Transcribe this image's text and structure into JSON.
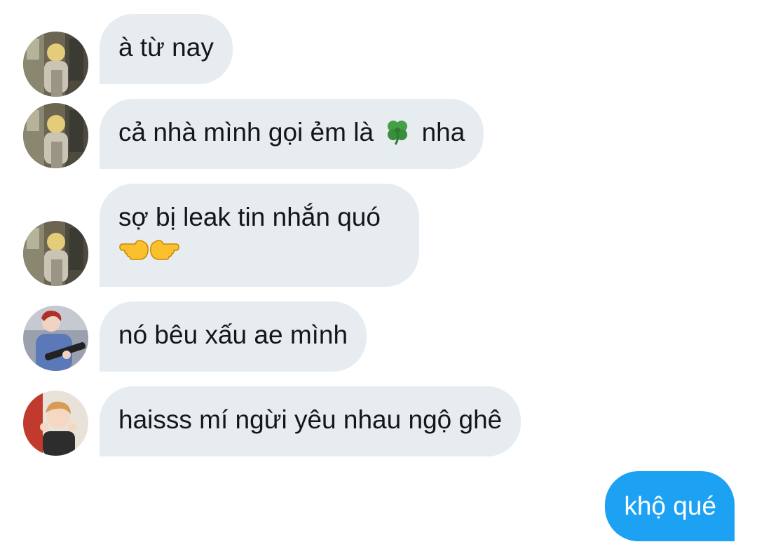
{
  "conversation": {
    "messages": [
      {
        "direction": "incoming",
        "sender_avatar": "avatar-blonde-street",
        "text": "à từ nay"
      },
      {
        "direction": "incoming",
        "sender_avatar": "avatar-blonde-street",
        "text_before_emoji": "cả nhà mình gọi ẻm là",
        "emoji": "four-leaf-clover",
        "text_after_emoji": "nha"
      },
      {
        "direction": "incoming",
        "sender_avatar": "avatar-blonde-street",
        "text": "sợ bị leak tin nhắn quó",
        "emojis": [
          "left-pointing-hand",
          "right-pointing-hand"
        ]
      },
      {
        "direction": "incoming",
        "sender_avatar": "avatar-guitarist",
        "text": "nó bêu xấu ae mình"
      },
      {
        "direction": "incoming",
        "sender_avatar": "avatar-portrait",
        "text": "haisss mí ngừi yêu nhau ngộ ghê"
      },
      {
        "direction": "outgoing",
        "text": "khộ qué"
      }
    ]
  },
  "colors": {
    "incoming_bubble": "#e6ecf0",
    "incoming_text": "#14171a",
    "outgoing_bubble": "#1da1f2",
    "outgoing_text": "#ffffff"
  }
}
